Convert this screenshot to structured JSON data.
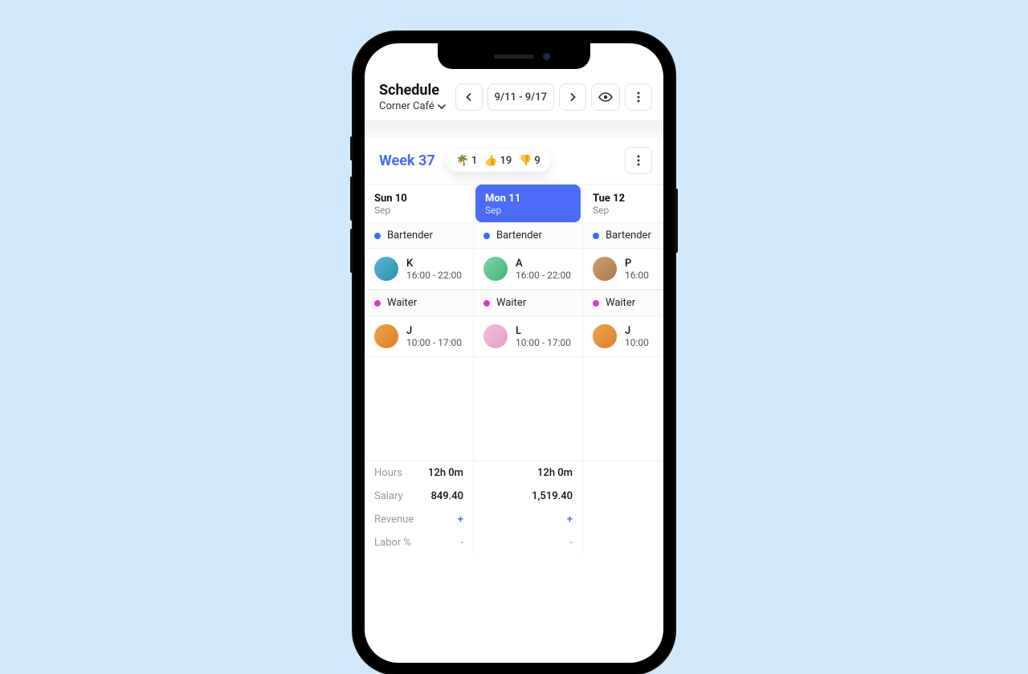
{
  "header": {
    "title": "Schedule",
    "location": "Corner Café",
    "date_range": "9/11 - 9/17"
  },
  "week": {
    "label": "Week 37",
    "reactions": {
      "palm": 1,
      "thumbs_up": 19,
      "thumbs_down": 9
    }
  },
  "days": [
    {
      "title": "Sun 10",
      "month": "Sep",
      "active": false,
      "roles": [
        {
          "name": "Bartender",
          "color": "blue",
          "shifts": [
            {
              "initial": "K",
              "time": "16:00 - 22:00",
              "avatar": "av1"
            }
          ]
        },
        {
          "name": "Waiter",
          "color": "pink",
          "shifts": [
            {
              "initial": "J",
              "time": "10:00 - 17:00",
              "avatar": "av2"
            }
          ]
        }
      ],
      "stats": {
        "hours": "12h 0m",
        "salary": "849.40",
        "revenue": "+",
        "labor": "-"
      }
    },
    {
      "title": "Mon 11",
      "month": "Sep",
      "active": true,
      "roles": [
        {
          "name": "Bartender",
          "color": "blue",
          "shifts": [
            {
              "initial": "A",
              "time": "16:00 - 22:00",
              "avatar": "av3"
            }
          ]
        },
        {
          "name": "Waiter",
          "color": "pink",
          "shifts": [
            {
              "initial": "L",
              "time": "10:00 - 17:00",
              "avatar": "av4"
            }
          ]
        }
      ],
      "stats": {
        "hours": "12h 0m",
        "salary": "1,519.40",
        "revenue": "+",
        "labor": "-"
      }
    },
    {
      "title": "Tue 12",
      "month": "Sep",
      "active": false,
      "roles": [
        {
          "name": "Bartender",
          "color": "blue",
          "shifts": [
            {
              "initial": "P",
              "time": "16:00",
              "avatar": "av5"
            }
          ]
        },
        {
          "name": "Waiter",
          "color": "pink",
          "shifts": [
            {
              "initial": "J",
              "time": "10:00",
              "avatar": "av2"
            }
          ]
        }
      ],
      "stats": {
        "hours": "",
        "salary": "",
        "revenue": "",
        "labor": ""
      }
    }
  ],
  "stat_labels": {
    "hours": "Hours",
    "salary": "Salary",
    "revenue": "Revenue",
    "labor": "Labor %"
  }
}
